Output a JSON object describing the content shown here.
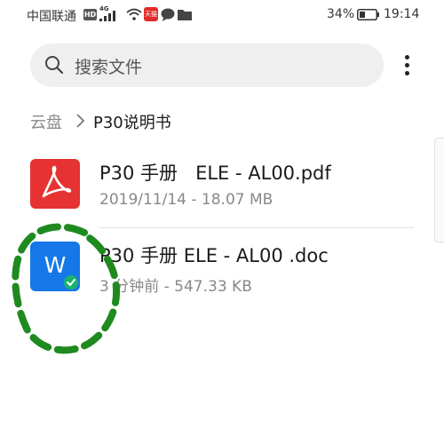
{
  "status_bar": {
    "carrier": "中国联通",
    "hd": "HD",
    "network": "4G",
    "app_badge": "天猫",
    "battery_percent": "34%",
    "time": "19:14",
    "icons": [
      "hd-icon",
      "signal-icon",
      "wifi-icon",
      "tmall-icon",
      "chat-icon",
      "folder-icon",
      "battery-icon"
    ]
  },
  "search": {
    "placeholder": "搜索文件",
    "icon": "search-icon"
  },
  "menu": {
    "icon": "more-vertical-icon"
  },
  "breadcrumb": {
    "root": "云盘",
    "separator_icon": "chevron-right-icon",
    "current": "P30说明书"
  },
  "files": [
    {
      "name": "P30 手册   ELE - AL00.pdf",
      "meta": "2019/11/14 - 18.07 MB",
      "type": "pdf",
      "icon": "pdf-icon",
      "icon_color": "#e63232"
    },
    {
      "name": "P30 手册 ELE - AL00 .doc",
      "meta": "3  分钟前 - 547.33 KB",
      "type": "doc",
      "icon": "word-icon",
      "icon_letter": "W",
      "icon_color": "#1678e8",
      "synced_badge": "check-icon"
    }
  ],
  "annotation": {
    "color": "#1f8a1f",
    "style": "dashed-circle"
  },
  "colors": {
    "accent_check": "#1cb36b",
    "search_bg": "#efefef",
    "muted_text": "#888888"
  }
}
